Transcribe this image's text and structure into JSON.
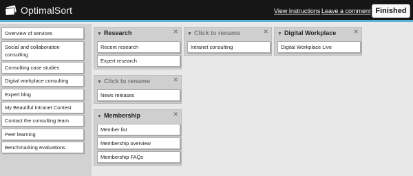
{
  "header": {
    "brand": "OptimalSort",
    "links": [
      "View instructions",
      "Leave a comment"
    ],
    "finished_label": "Finished"
  },
  "sidebar": {
    "cards": [
      "Overview of services",
      "Social and collaboration consulting",
      "Consulting case studies",
      "Digital workplace consulting",
      "Expert blog",
      "My Beautiful Intranet Contest",
      "Contact the consulting team",
      "Peer learning",
      "Benchmarking evaluations"
    ]
  },
  "groups": [
    {
      "title": "Research",
      "cards": [
        "Recent research",
        "Expert research"
      ]
    },
    {
      "title": "Click to rename",
      "cards": [
        "News releases"
      ]
    },
    {
      "title": "Membership",
      "cards": [
        "Member list",
        "Membership overview",
        "Membership FAQs"
      ]
    },
    {
      "title": "Click to rename",
      "cards": [
        "Intranet consulting"
      ]
    },
    {
      "title": "Digital Workplace",
      "cards": [
        "Digital Workplace Live"
      ]
    }
  ],
  "icons": {
    "collapse": "triangle-down-icon",
    "close": "close-x-icon",
    "logo": "card-deck-icon"
  },
  "colors": {
    "header_bg": "#161616",
    "header_accent": "#5ab3d3",
    "workspace_bg": "#e8e8e8",
    "group_bg": "#cfcfcf",
    "sidebar_bg": "#d2d2d2"
  }
}
